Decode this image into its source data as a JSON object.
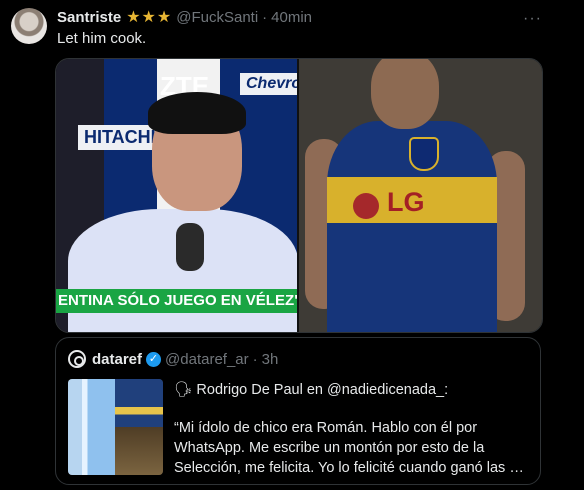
{
  "tweet": {
    "author_name": "Santriste",
    "author_stars": "★★★",
    "handle": "@FuckSanti",
    "separator": "·",
    "time": "40min",
    "more_label": "···",
    "text": "Let him cook."
  },
  "media": {
    "left_caption": "ENTINA SÓLO JUEGO EN VÉLEZ\"",
    "left_sponsors": [
      "ZTE",
      "Chevrolet",
      "HITACHI"
    ],
    "right_sponsor": "LG"
  },
  "quote": {
    "avatar_icon": "dataref-logo-icon",
    "name": "dataref",
    "verified_icon": "verified-badge-icon",
    "handle": "@dataref_ar",
    "separator": "·",
    "time": "3h",
    "emoji": "🗣",
    "line1": "Rodrigo De Paul en @nadiedicenada_:",
    "line2": "“Mi ídolo de chico era Román. Hablo con él por WhatsApp. Me escribe un montón por esto de la Selección, me felicita. Yo lo felicité cuando ganó las …"
  }
}
